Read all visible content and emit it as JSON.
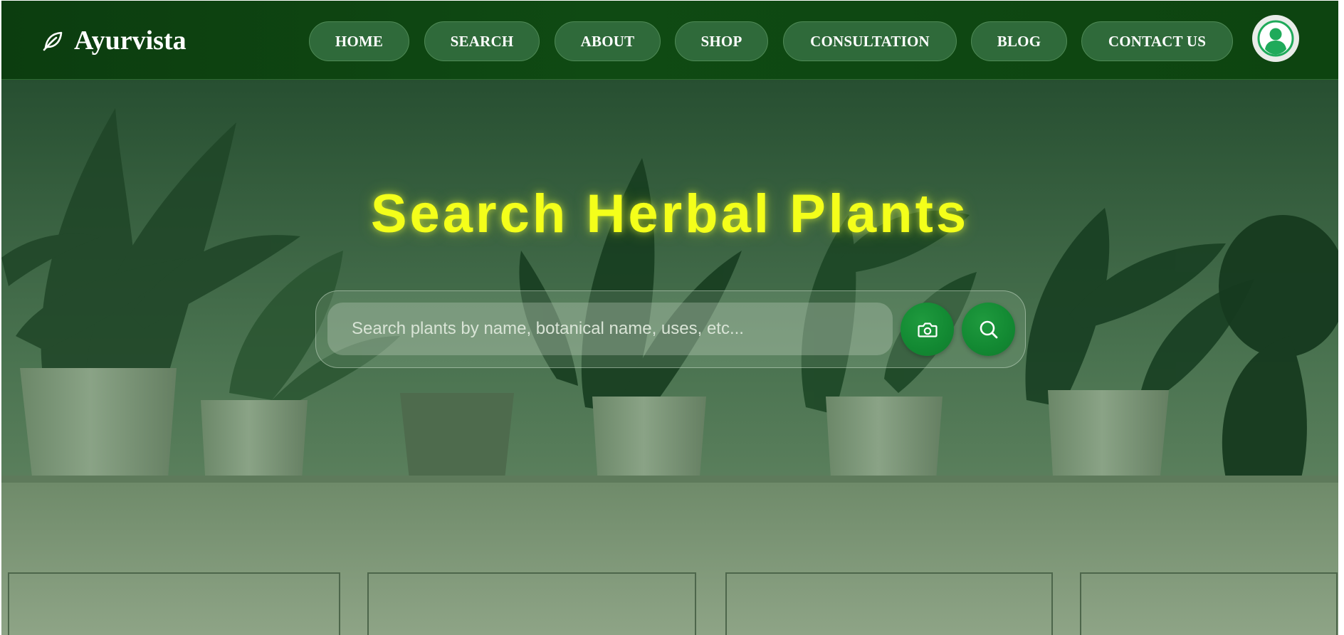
{
  "header": {
    "brand": "Ayurvista",
    "brand_icon": "leaf-icon",
    "nav": {
      "home": "HOME",
      "search": "SEARCH",
      "about": "ABOUT",
      "shop": "SHOP",
      "consultation": "CONSULTATION",
      "blog": "BLOG",
      "contact": "CONTACT US"
    },
    "avatar_icon": "user-icon"
  },
  "hero": {
    "title": "Search Herbal Plants",
    "search": {
      "value": "",
      "placeholder": "Search plants by name, botanical name, uses, etc...",
      "camera_icon": "camera-icon",
      "submit_icon": "search-icon"
    }
  },
  "colors": {
    "nav_bg": "#0f4a13",
    "nav_button": "#2f6a3a",
    "title": "#f4ff1a",
    "action_button": "#138a33",
    "avatar_accent": "#1faa5a"
  }
}
